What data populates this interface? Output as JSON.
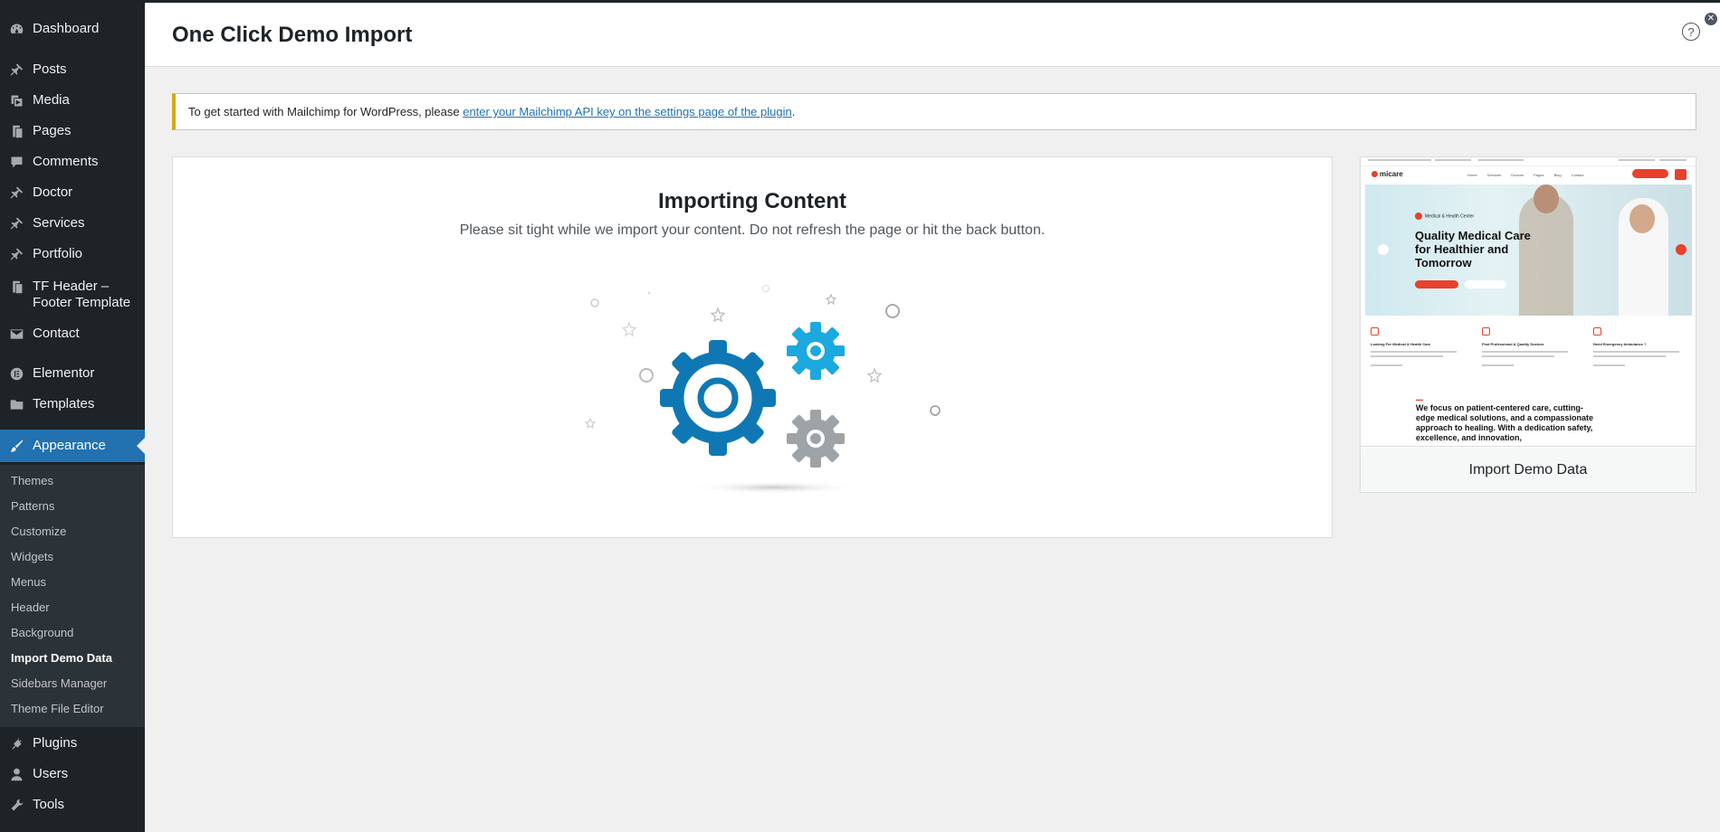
{
  "sidebar": {
    "items": [
      {
        "label": "Dashboard",
        "icon": "dashboard-icon"
      },
      {
        "label": "Posts",
        "icon": "pin-icon"
      },
      {
        "label": "Media",
        "icon": "media-icon"
      },
      {
        "label": "Pages",
        "icon": "pages-icon"
      },
      {
        "label": "Comments",
        "icon": "comments-icon"
      },
      {
        "label": "Doctor",
        "icon": "pin-icon"
      },
      {
        "label": "Services",
        "icon": "pin-icon"
      },
      {
        "label": "Portfolio",
        "icon": "pin-icon"
      },
      {
        "label": "TF Header – Footer Template",
        "icon": "pages-icon"
      },
      {
        "label": "Contact",
        "icon": "mail-icon"
      },
      {
        "label": "Elementor",
        "icon": "elementor-icon"
      },
      {
        "label": "Templates",
        "icon": "folder-icon"
      },
      {
        "label": "Appearance",
        "icon": "brush-icon"
      },
      {
        "label": "Plugins",
        "icon": "plugin-icon"
      },
      {
        "label": "Users",
        "icon": "user-icon"
      },
      {
        "label": "Tools",
        "icon": "wrench-icon"
      }
    ],
    "submenu": [
      "Themes",
      "Patterns",
      "Customize",
      "Widgets",
      "Menus",
      "Header",
      "Background",
      "Import Demo Data",
      "Sidebars Manager",
      "Theme File Editor"
    ],
    "current_submenu": "Import Demo Data"
  },
  "header": {
    "title": "One Click Demo Import",
    "help": "?"
  },
  "notice": {
    "text": "To get started with Mailchimp for WordPress, please ",
    "link": "enter your Mailchimp API key on the settings page of the plugin",
    "suffix": "."
  },
  "importing": {
    "title": "Importing Content",
    "subtitle": "Please sit tight while we import your content. Do not refresh the page or hit the back button."
  },
  "preview": {
    "footer_label": "Import Demo Data",
    "logo": "micare",
    "nav": "Home Services Doctors Pages Blog Contact",
    "hero_tag": "Medical & Health Center",
    "hero_title": "Quality Medical Care for Healthier and Tomorrow",
    "features": [
      "Looking For Medical & Health Care",
      "Find Professional & Quality Doctors",
      "Need Emergency Ambulance ?"
    ],
    "quote": "We focus on patient-centered care, cutting-edge medical solutions, and a compassionate approach to healing. With a dedication safety, excellence, and innovation,"
  },
  "colors": {
    "sidebar_bg": "#1d2327",
    "accent": "#2271b1",
    "notice_border": "#dba617",
    "gear_blue": "#0f78b4",
    "gear_light_blue": "#1ba9df",
    "gear_grey": "#9ea3a8"
  }
}
